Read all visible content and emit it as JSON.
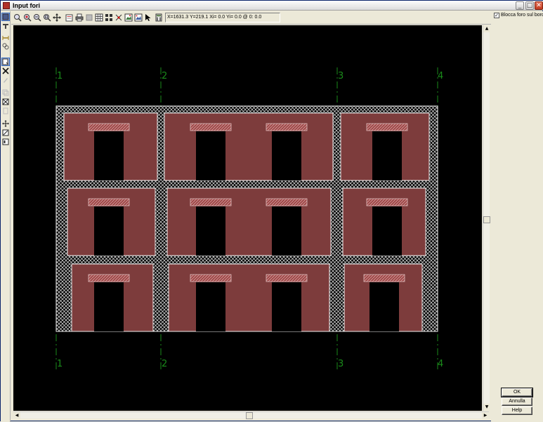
{
  "window": {
    "title": "Input fori",
    "min_glyph": "_",
    "max_glyph": "□",
    "close_glyph": "✕"
  },
  "left_toolbar": {
    "tools": [
      "select-icon",
      "pointer-icon",
      "level-icon",
      "chain-icon",
      "new-opening-icon",
      "delete-icon",
      "edit-disabled-icon",
      "copy-disabled-icon",
      "cross-box-icon",
      "paste-disabled-icon",
      "move-icon",
      "resize-icon",
      "properties-icon"
    ]
  },
  "top_toolbar": {
    "tools": [
      "zoom-window-icon",
      "zoom-in-icon",
      "zoom-out-icon",
      "zoom-all-icon",
      "pan-icon",
      "print-preview-icon",
      "print-icon",
      "blank-icon",
      "grid-icon",
      "snap-icon",
      "snap-point-icon",
      "image-icon",
      "image2-icon",
      "pointer-arrow-icon",
      "calc-icon"
    ],
    "coordinates": "X=1631.3 Y=219.1 Xi= 0.0 Yi= 0.0 @ 0: 0.0"
  },
  "drawing": {
    "grid_labels": [
      "1",
      "2",
      "3",
      "4"
    ],
    "floors": 3,
    "colors": {
      "background": "#000000",
      "wall": "#7d3c3c",
      "opening": "#000000",
      "lintel": "#a04848",
      "hatch": "#e8e8e8",
      "grid": "#1a8a1a",
      "outline": "#f0f0f0"
    }
  },
  "right_panel": {
    "lock_checkbox_checked": true,
    "lock_checkbox_mark": "✓",
    "lock_checkbox_label": "Blocca foro sul bordo",
    "ok_label": "OK",
    "annulla_label": "Annulla",
    "help_label": "Help"
  },
  "scrollbars": {
    "up": "▲",
    "down": "▼",
    "left": "◀",
    "right": "▶"
  }
}
